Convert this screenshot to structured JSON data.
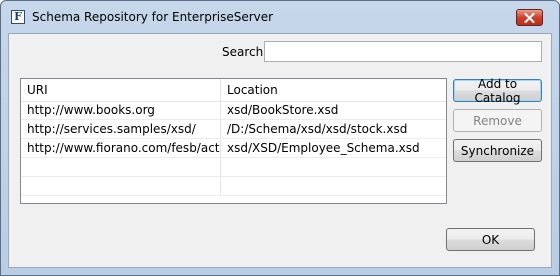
{
  "window": {
    "icon_glyph": "F",
    "title": "Schema Repository for EnterpriseServer",
    "close_icon": "close-x-icon"
  },
  "search": {
    "label": "Search:",
    "value": ""
  },
  "table": {
    "columns": [
      "URI",
      "Location"
    ],
    "rows": [
      {
        "uri": "http://www.books.org",
        "location": "xsd/BookStore.xsd"
      },
      {
        "uri": "http://services.samples/xsd/",
        "location": "/D:/Schema/xsd/xsd/stock.xsd"
      },
      {
        "uri": "http://www.fiorano.com/fesb/acti...",
        "location": "xsd/XSD/Employee_Schema.xsd"
      },
      {
        "uri": "",
        "location": ""
      },
      {
        "uri": "",
        "location": ""
      }
    ]
  },
  "buttons": {
    "add_to_catalog": "Add to Catalog",
    "remove": "Remove",
    "synchronize": "Synchronize",
    "ok": "OK"
  },
  "colors": {
    "titlebar": "#b9cde4",
    "close_button": "#c9412c",
    "client_background": "#f0f0f0",
    "focus_border": "#3c7fb1"
  }
}
